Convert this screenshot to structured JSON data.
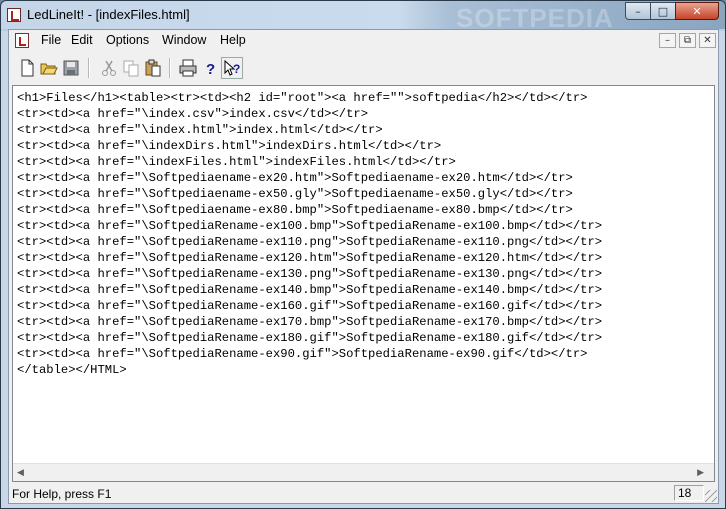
{
  "window": {
    "title": "LedLineIt! - [indexFiles.html]",
    "watermark": "SOFTPEDIA"
  },
  "caption_buttons": {
    "minimize": "–",
    "maximize": "□",
    "close": "✕"
  },
  "menu": [
    "File",
    "Edit",
    "Options",
    "Window",
    "Help"
  ],
  "mdi_buttons": {
    "minimize": "–",
    "restore": "⧉",
    "close": "✕"
  },
  "toolbar": [
    "new-file-icon",
    "open-folder-icon",
    "save-icon",
    "cut-icon",
    "copy-icon",
    "paste-icon",
    "print-icon",
    "help-icon",
    "context-help-icon"
  ],
  "editor": {
    "lines": [
      "<h1>Files</h1><table><tr><td><h2 id=\"root\"><a href=\"\">softpedia</h2></td></tr>",
      "<tr><td><a href=\"\\index.csv\">index.csv</td></tr>",
      "<tr><td><a href=\"\\index.html\">index.html</td></tr>",
      "<tr><td><a href=\"\\indexDirs.html\">indexDirs.html</td></tr>",
      "<tr><td><a href=\"\\indexFiles.html\">indexFiles.html</td></tr>",
      "<tr><td><a href=\"\\Softpediaename-ex20.htm\">Softpediaename-ex20.htm</td></tr>",
      "<tr><td><a href=\"\\Softpediaename-ex50.gly\">Softpediaename-ex50.gly</td></tr>",
      "<tr><td><a href=\"\\Softpediaename-ex80.bmp\">Softpediaename-ex80.bmp</td></tr>",
      "<tr><td><a href=\"\\SoftpediaRename-ex100.bmp\">SoftpediaRename-ex100.bmp</td></tr>",
      "<tr><td><a href=\"\\SoftpediaRename-ex110.png\">SoftpediaRename-ex110.png</td></tr>",
      "<tr><td><a href=\"\\SoftpediaRename-ex120.htm\">SoftpediaRename-ex120.htm</td></tr>",
      "<tr><td><a href=\"\\SoftpediaRename-ex130.png\">SoftpediaRename-ex130.png</td></tr>",
      "<tr><td><a href=\"\\SoftpediaRename-ex140.bmp\">SoftpediaRename-ex140.bmp</td></tr>",
      "<tr><td><a href=\"\\SoftpediaRename-ex160.gif\">SoftpediaRename-ex160.gif</td></tr>",
      "<tr><td><a href=\"\\SoftpediaRename-ex170.bmp\">SoftpediaRename-ex170.bmp</td></tr>",
      "<tr><td><a href=\"\\SoftpediaRename-ex180.gif\">SoftpediaRename-ex180.gif</td></tr>",
      "<tr><td><a href=\"\\SoftpediaRename-ex90.gif\">SoftpediaRename-ex90.gif</td></tr>",
      "</table></HTML>"
    ]
  },
  "status": {
    "help_text": "For Help, press F1",
    "line_number": "18"
  }
}
